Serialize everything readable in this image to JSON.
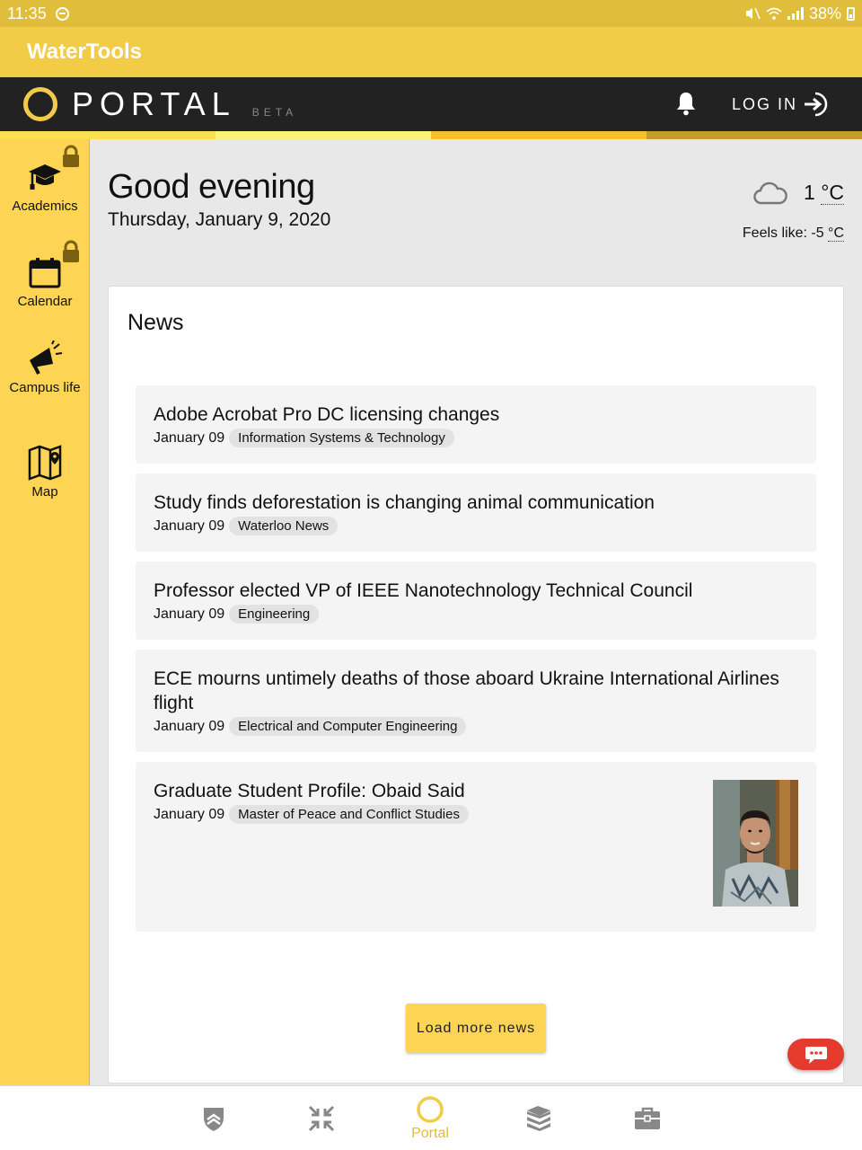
{
  "status_bar": {
    "time": "11:35",
    "battery": "38%"
  },
  "app": {
    "title": "WaterTools"
  },
  "portal_header": {
    "title": "PORTAL",
    "beta": "BETA",
    "login_label": "LOG IN"
  },
  "colors": {
    "accent": "#fed454",
    "header_dark": "#222222",
    "chat_red": "#e53a2e"
  },
  "sidebar": {
    "items": [
      {
        "label": "Academics",
        "icon": "graduation-cap-icon",
        "locked": true
      },
      {
        "label": "Calendar",
        "icon": "calendar-icon",
        "locked": true
      },
      {
        "label": "Campus life",
        "icon": "megaphone-icon",
        "locked": false
      },
      {
        "label": "Map",
        "icon": "map-icon",
        "locked": false
      }
    ]
  },
  "greeting": {
    "title": "Good evening",
    "date": "Thursday, January 9, 2020"
  },
  "weather": {
    "icon": "cloud-icon",
    "temp": "1",
    "unit": "°C",
    "feels_label": "Feels like: -5",
    "feels_unit": "°C"
  },
  "news": {
    "title": "News",
    "items": [
      {
        "headline": "Adobe Acrobat Pro DC licensing changes",
        "date": "January 09",
        "tag": "Information Systems & Technology"
      },
      {
        "headline": "Study finds deforestation is changing animal communication",
        "date": "January 09",
        "tag": "Waterloo News"
      },
      {
        "headline": "Professor elected VP of IEEE Nanotechnology Technical Council",
        "date": "January 09",
        "tag": "Engineering"
      },
      {
        "headline": "ECE mourns untimely deaths of those aboard Ukraine International Airlines flight",
        "date": "January 09",
        "tag": "Electrical and Computer Engineering"
      },
      {
        "headline": "Graduate Student Profile: Obaid Said",
        "date": "January 09",
        "tag": "Master of Peace and Conflict Studies"
      }
    ],
    "load_more": "Load more news"
  },
  "bottom_nav": {
    "items": [
      {
        "icon": "shield-icon"
      },
      {
        "icon": "collapse-arrows-icon"
      },
      {
        "icon": "portal-ring-icon",
        "label": "Portal",
        "active": true
      },
      {
        "icon": "books-icon"
      },
      {
        "icon": "briefcase-icon"
      }
    ]
  }
}
